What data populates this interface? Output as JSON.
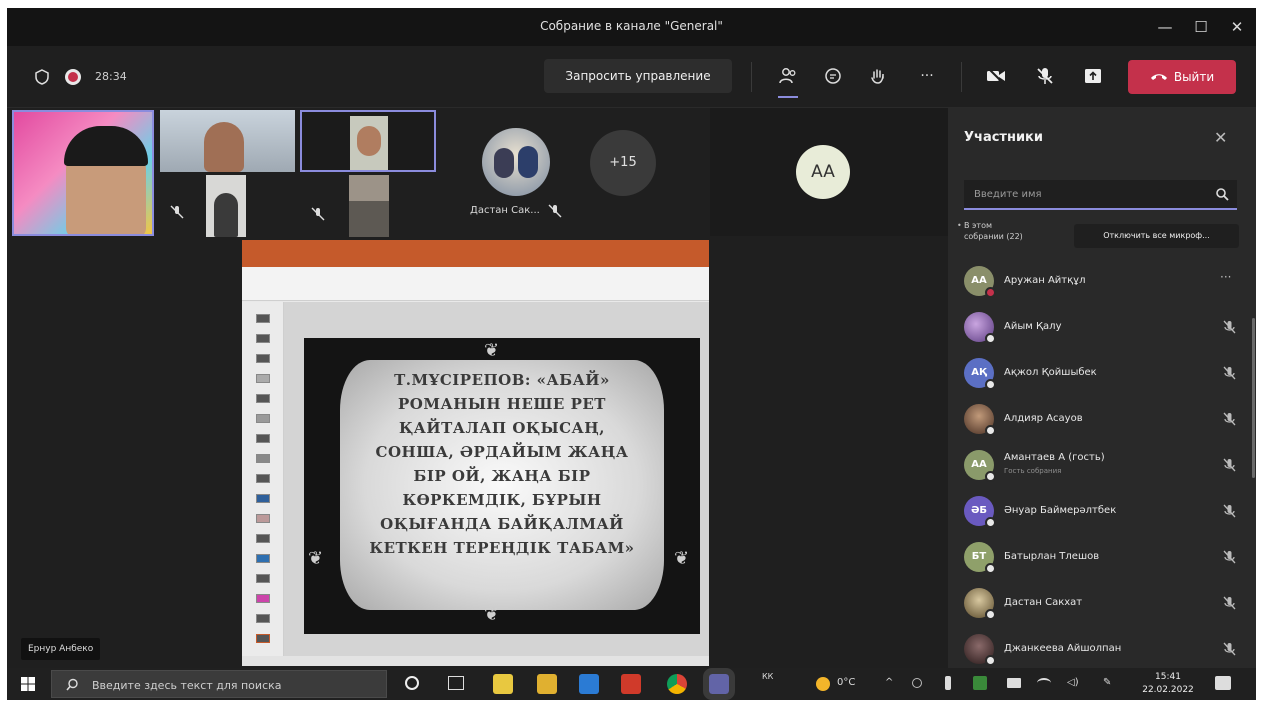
{
  "window": {
    "title": "Собрание в канале \"General\"",
    "minimize": "—",
    "maximize": "☐",
    "close": "✕"
  },
  "toolbar": {
    "timer": "28:34",
    "request_control": "Запросить управление",
    "more": "···",
    "leave": "Выйти"
  },
  "video": {
    "overflow_count": "+15",
    "avatar_initials": "AA",
    "tile_name": "Дастан Сак...",
    "presenter_name": "Ернур Анбеко"
  },
  "shared_slide": {
    "lines": [
      "Т.МҰСІРЕПОВ: «АБАЙ»",
      "РОМАНЫН НЕШЕ РЕТ",
      "ҚАЙТАЛАП ОҚЫСАҢ,",
      "СОНША, ӘРДАЙЫМ ЖАҢА",
      "БІР ОЙ, ЖАҢА БІР",
      "КӨРКЕМДІК, БҰРЫН",
      "ОҚЫҒАНДА БАЙҚАЛМАЙ",
      "КЕТКЕН ТЕРЕҢДІК ТАБАМ»"
    ]
  },
  "participants_panel": {
    "title": "Участники",
    "search_placeholder": "Введите имя",
    "section_label": "В этом собрании (22)",
    "mute_all": "Отключить все микроф...",
    "participants": [
      {
        "name": "Аружан Айтқұл",
        "initials": "АА",
        "color": "#8a8f6a",
        "subtitle": "",
        "mic": "more"
      },
      {
        "name": "Айым Қалу",
        "initials": "",
        "color": "#7a5ab0",
        "subtitle": "",
        "mic": "muted"
      },
      {
        "name": "Ақжол Қойшыбек",
        "initials": "АҚ",
        "color": "#5b6fc4",
        "subtitle": "",
        "mic": "muted"
      },
      {
        "name": "Алдияр Асауов",
        "initials": "",
        "color": "#6b4a3a",
        "subtitle": "",
        "mic": "muted"
      },
      {
        "name": "Амантаев А (гость)",
        "initials": "АА",
        "color": "#8a9a6a",
        "subtitle": "Гость собрания",
        "mic": "muted"
      },
      {
        "name": "Әнуар Баймерәлтбек",
        "initials": "ӘБ",
        "color": "#6a5ac0",
        "subtitle": "",
        "mic": "muted"
      },
      {
        "name": "Батырлан Тлешов",
        "initials": "БТ",
        "color": "#8fa06a",
        "subtitle": "",
        "mic": "muted"
      },
      {
        "name": "Дастан Сакхат",
        "initials": "",
        "color": "#7a6a4a",
        "subtitle": "",
        "mic": "muted"
      },
      {
        "name": "Джанкеева Айшолпан",
        "initials": "",
        "color": "#4a3a3a",
        "subtitle": "",
        "mic": "muted"
      }
    ]
  },
  "taskbar": {
    "search_placeholder": "Введите здесь текст для поиска",
    "lang": "КК",
    "weather": "0°C",
    "time": "15:41",
    "date": "22.02.2022"
  }
}
